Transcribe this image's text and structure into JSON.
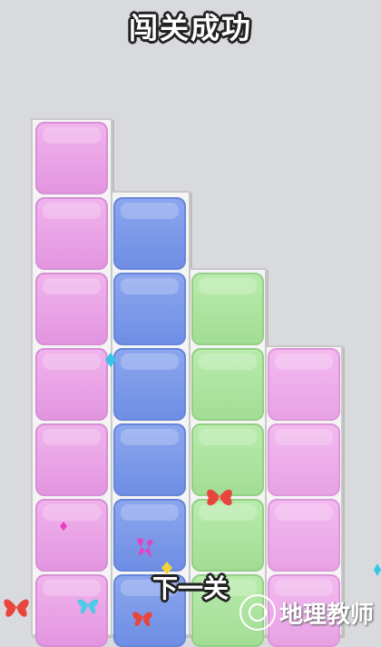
{
  "header": {
    "title": "闯关成功"
  },
  "board": {
    "columns": [
      {
        "cells": [
          "pink",
          "pink",
          "pink",
          "pink",
          "pink",
          "pink",
          "pink"
        ]
      },
      {
        "cells": [
          "blue",
          "blue",
          "blue",
          "blue",
          "blue",
          "blue"
        ]
      },
      {
        "cells": [
          "green",
          "green",
          "green",
          "green",
          "green"
        ]
      },
      {
        "cells": [
          "pink2",
          "pink2",
          "pink2",
          "pink2"
        ]
      }
    ]
  },
  "footer": {
    "next_label": "下一关"
  },
  "watermark": {
    "text": "地理教师"
  },
  "colors": {
    "pink": "#e395e0",
    "blue": "#6f8ee4",
    "green": "#a2dd94",
    "pink2": "#e8a2e4",
    "background": "#d9dadd"
  }
}
